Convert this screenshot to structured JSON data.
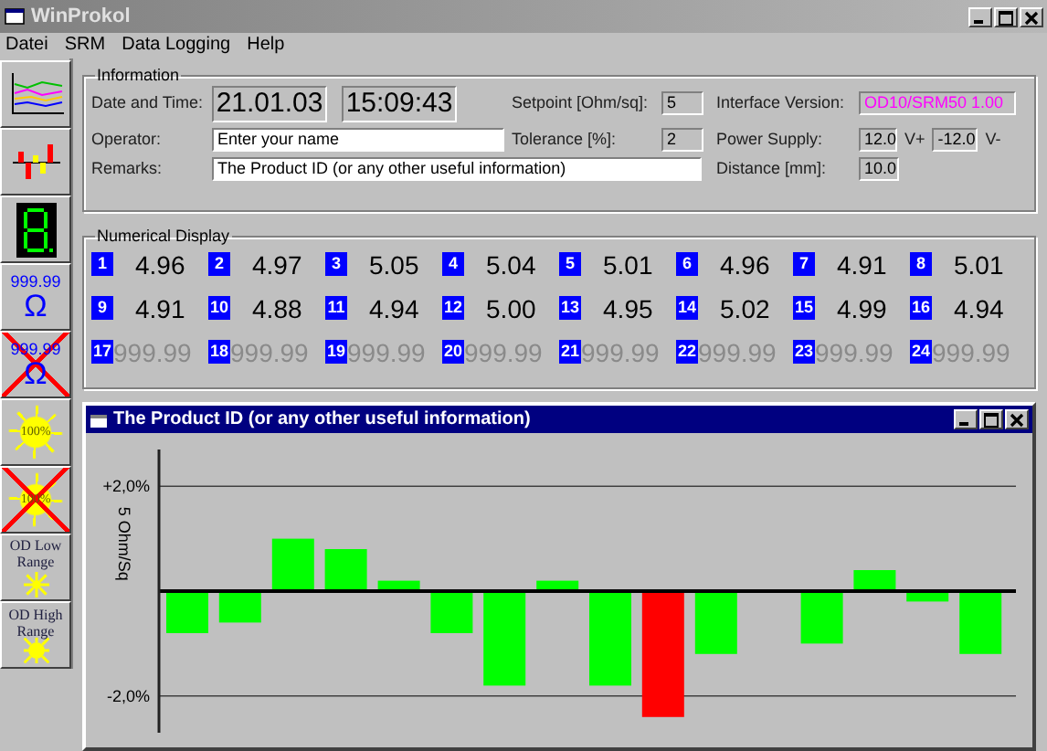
{
  "window": {
    "title": "WinProkol"
  },
  "menu": [
    {
      "label": "Datei"
    },
    {
      "label": "SRM"
    },
    {
      "label": "Data Logging"
    },
    {
      "label": "Help"
    }
  ],
  "toolbar": [
    {
      "kind": "graph"
    },
    {
      "kind": "bars"
    },
    {
      "kind": "digit"
    },
    {
      "kind": "ohm",
      "text": "999.99",
      "symbol": "Ω"
    },
    {
      "kind": "ohm_off",
      "text": "999.99",
      "symbol": "Ω"
    },
    {
      "kind": "sun",
      "text": "100%"
    },
    {
      "kind": "sun_off",
      "text": "100%"
    },
    {
      "kind": "range_low",
      "text": "OD Low Range"
    },
    {
      "kind": "range_high",
      "text": "OD High Range"
    }
  ],
  "information": {
    "title": "Information",
    "date_label": "Date and Time:",
    "date": "21.01.03",
    "time": "15:09:43",
    "operator_label": "Operator:",
    "operator": "Enter your name",
    "remarks_label": "Remarks:",
    "remarks": "The Product ID (or any other useful information)",
    "setpoint_label": "Setpoint [Ohm/sq]:",
    "setpoint": "5",
    "tolerance_label": "Tolerance [%]:",
    "tolerance": "2",
    "interface_label": "Interface Version:",
    "interface": "OD10/SRM50 1.00",
    "power_label": "Power Supply:",
    "power_plus": "12.0",
    "power_plus_unit": "V+",
    "power_minus": "-12.0",
    "power_minus_unit": "V-",
    "distance_label": "Distance [mm]:",
    "distance": "10.0"
  },
  "numerical_display": {
    "title": "Numerical Display",
    "channels": [
      {
        "number": "1",
        "value": "4.96",
        "active": true
      },
      {
        "number": "2",
        "value": "4.97",
        "active": true
      },
      {
        "number": "3",
        "value": "5.05",
        "active": true
      },
      {
        "number": "4",
        "value": "5.04",
        "active": true
      },
      {
        "number": "5",
        "value": "5.01",
        "active": true
      },
      {
        "number": "6",
        "value": "4.96",
        "active": true
      },
      {
        "number": "7",
        "value": "4.91",
        "active": true
      },
      {
        "number": "8",
        "value": "5.01",
        "active": true
      },
      {
        "number": "9",
        "value": "4.91",
        "active": true
      },
      {
        "number": "10",
        "value": "4.88",
        "active": true
      },
      {
        "number": "11",
        "value": "4.94",
        "active": true
      },
      {
        "number": "12",
        "value": "5.00",
        "active": true
      },
      {
        "number": "13",
        "value": "4.95",
        "active": true
      },
      {
        "number": "14",
        "value": "5.02",
        "active": true
      },
      {
        "number": "15",
        "value": "4.99",
        "active": true
      },
      {
        "number": "16",
        "value": "4.94",
        "active": true
      },
      {
        "number": "17",
        "value": "999.99",
        "active": false
      },
      {
        "number": "18",
        "value": "999.99",
        "active": false
      },
      {
        "number": "19",
        "value": "999.99",
        "active": false
      },
      {
        "number": "20",
        "value": "999.99",
        "active": false
      },
      {
        "number": "21",
        "value": "999.99",
        "active": false
      },
      {
        "number": "22",
        "value": "999.99",
        "active": false
      },
      {
        "number": "23",
        "value": "999.99",
        "active": false
      },
      {
        "number": "24",
        "value": "999.99",
        "active": false
      }
    ]
  },
  "chart_window": {
    "title": "The Product ID (or any other useful information)",
    "chart_data": {
      "type": "bar",
      "ylabel": "5 Ohm/Sq",
      "ylim": [
        -2.7,
        2.7
      ],
      "yticks": [
        {
          "value": 2,
          "label": "+2,0%"
        },
        {
          "value": -2,
          "label": "-2,0%"
        }
      ],
      "series": [
        {
          "color": "#00ff00",
          "values": [
            -0.8,
            -0.6,
            1.0,
            0.8,
            0.2,
            -0.8,
            -1.8,
            0.2,
            -1.8,
            null,
            -1.2,
            0,
            -1.0,
            0.4,
            -0.2,
            -1.2
          ]
        },
        {
          "color": "#ff0000",
          "values": [
            null,
            null,
            null,
            null,
            null,
            null,
            null,
            null,
            null,
            -2.4,
            null,
            null,
            null,
            null,
            null,
            null
          ]
        }
      ]
    }
  }
}
